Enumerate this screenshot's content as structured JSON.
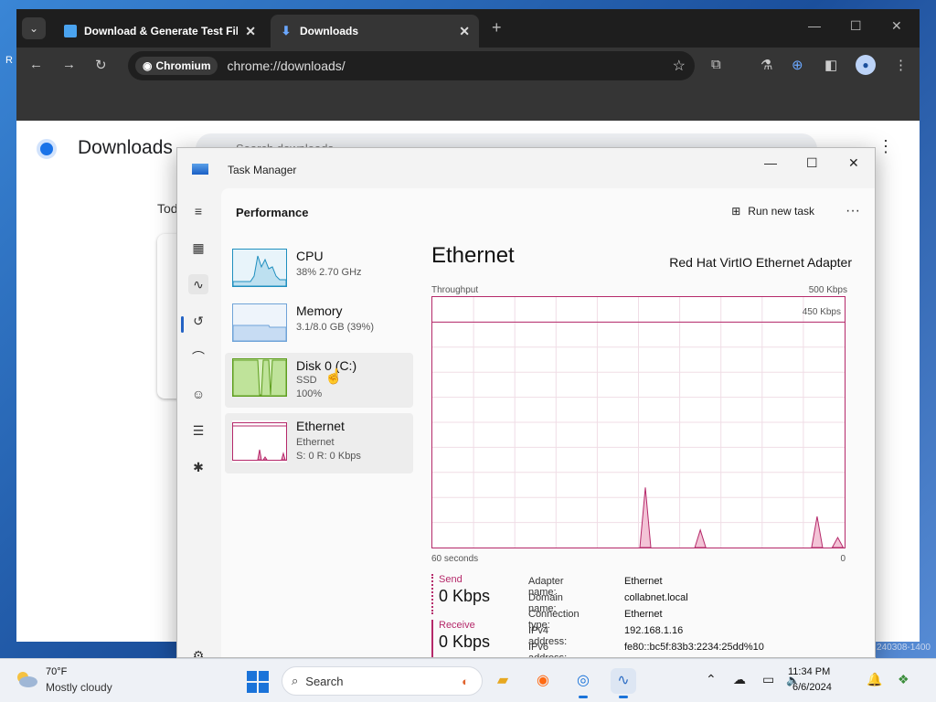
{
  "browser": {
    "tabs": [
      {
        "title": "Download & Generate Test File",
        "active": false
      },
      {
        "title": "Downloads",
        "active": true
      }
    ],
    "omnibox_chip": "Chromium",
    "url": "chrome://downloads/",
    "page": {
      "title": "Downloads",
      "search_placeholder": "Search downloads",
      "section_today": "Tod"
    }
  },
  "task_manager": {
    "window_title": "Task Manager",
    "header_title": "Performance",
    "run_new_task_label": "Run new task",
    "perf_items": [
      {
        "name": "CPU",
        "sub1": "38%  2.70 GHz",
        "sub2": ""
      },
      {
        "name": "Memory",
        "sub1": "3.1/8.0 GB (39%)",
        "sub2": ""
      },
      {
        "name": "Disk 0 (C:)",
        "sub1": "SSD",
        "sub2": "100%"
      },
      {
        "name": "Ethernet",
        "sub1": "Ethernet",
        "sub2": "S: 0  R: 0 Kbps"
      }
    ],
    "detail": {
      "title": "Ethernet",
      "adapter": "Red Hat VirtIO Ethernet Adapter",
      "throughput_label": "Throughput",
      "max_label": "500 Kbps",
      "line_label": "450 Kbps",
      "x_left_label": "60 seconds",
      "x_right_label": "0",
      "send_label": "Send",
      "send_value": "0 Kbps",
      "receive_label": "Receive",
      "receive_value": "0 Kbps",
      "properties": [
        {
          "key": "Adapter name:",
          "value": "Ethernet"
        },
        {
          "key": "Domain name:",
          "value": "collabnet.local"
        },
        {
          "key": "Connection type:",
          "value": "Ethernet"
        },
        {
          "key": "IPv4 address:",
          "value": "192.168.1.16"
        },
        {
          "key": "IPv6 address:",
          "value": "fe80::bc5f:83b3:2234:25dd%10"
        }
      ]
    },
    "throughput_series": {
      "x_range_seconds": [
        60,
        0
      ],
      "y_max_kbps": 500,
      "peaks_kbps": [
        {
          "seconds_ago": 29,
          "value": 120
        },
        {
          "seconds_ago": 21,
          "value": 35
        },
        {
          "seconds_ago": 4,
          "value": 62
        },
        {
          "seconds_ago": 1,
          "value": 20
        }
      ]
    }
  },
  "taskbar": {
    "weather_temp": "70°F",
    "weather_desc": "Mostly cloudy",
    "search_label": "Search",
    "time": "11:34 PM",
    "date": "6/6/2024"
  },
  "desktop": {
    "watermark": "240308-1400"
  },
  "colors": {
    "ethernet_accent": "#b5296a",
    "cpu_accent": "#1f8fbf",
    "memory_accent": "#6fa3d8",
    "disk_accent": "#5e9e1e"
  }
}
